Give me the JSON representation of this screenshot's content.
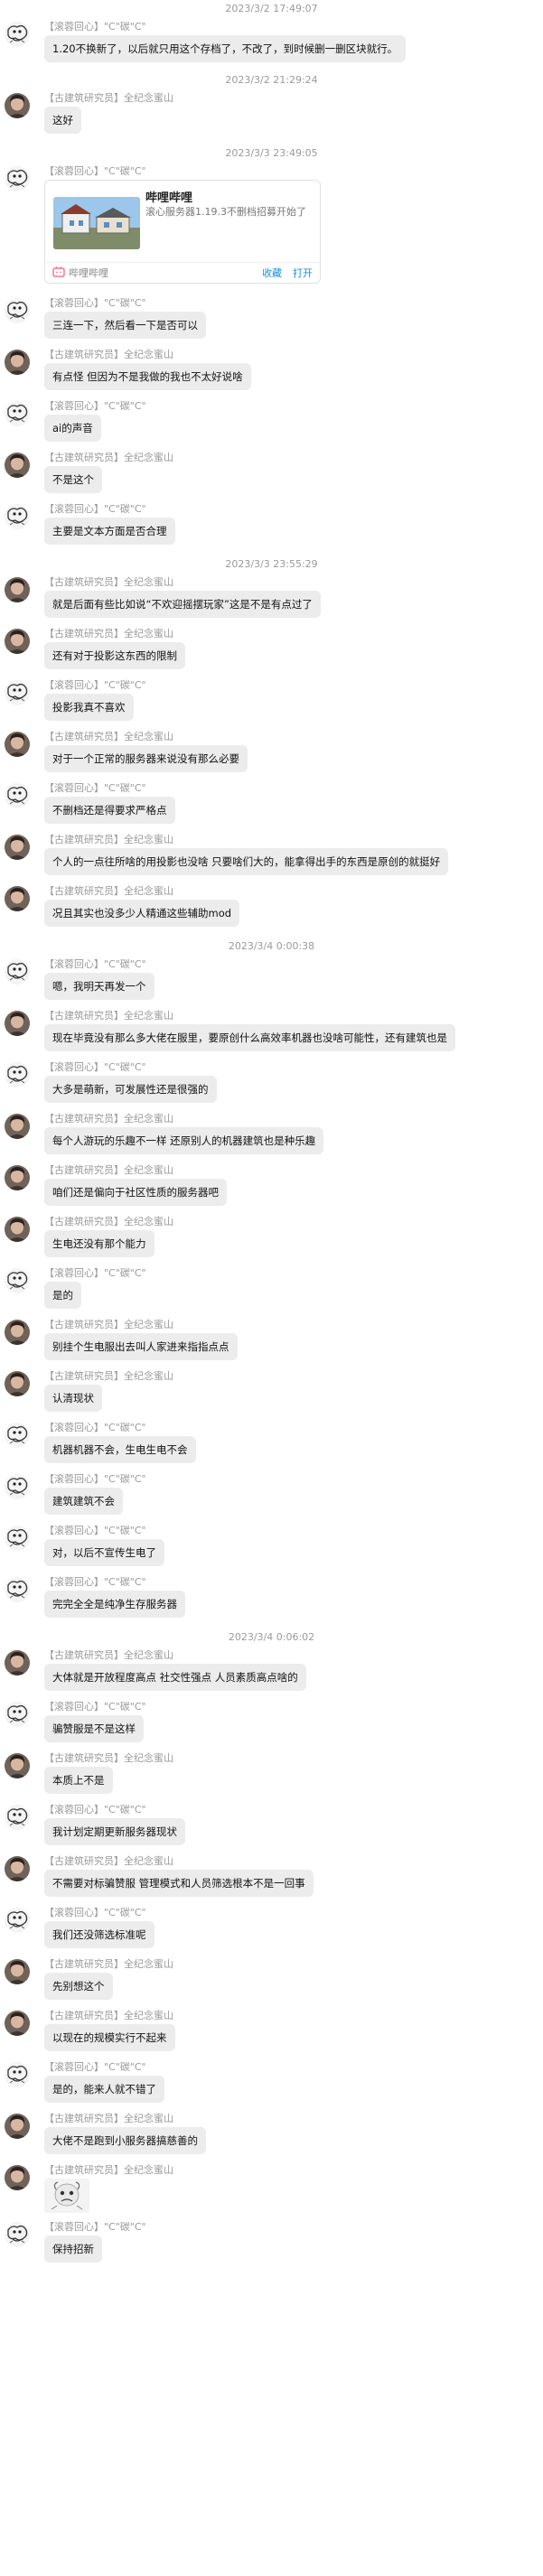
{
  "colors": {
    "bubble": "#ececec",
    "timestamp": "#9a9a9a",
    "link": "#1e8fd8",
    "bili_pink": "#fb7299"
  },
  "entries": [
    {
      "type": "ts",
      "text": "2023/3/2 17:49:07"
    },
    {
      "type": "msg",
      "who": "A",
      "name": "【滚蓉回心】\"C\"碳\"C\"",
      "text": "1.20不换新了，以后就只用这个存档了，不改了，到时候删一删区块就行。",
      "gap": 10
    },
    {
      "type": "ts",
      "text": "2023/3/2 21:29:24"
    },
    {
      "type": "msg",
      "who": "B",
      "name": "【古建筑研究员】全纪念蜜山",
      "text": "这好",
      "gap": 12
    },
    {
      "type": "ts",
      "text": "2023/3/3 23:49:05"
    },
    {
      "type": "card",
      "who": "A",
      "name": "【滚蓉回心】\"C\"碳\"C\"",
      "gap": 12,
      "card": {
        "title": "哔哩哔哩",
        "desc": "滚心服务器1.19.3不删档招募开始了",
        "source": "哔哩哔哩",
        "actions": [
          "收藏",
          "打开"
        ]
      }
    },
    {
      "type": "msg",
      "who": "A",
      "name": "【滚蓉回心】\"C\"碳\"C\"",
      "text": "三连一下，然后看一下是否可以",
      "gap": 8
    },
    {
      "type": "msg",
      "who": "B",
      "name": "【古建筑研究员】全纪念蜜山",
      "text": "有点怪 但因为不是我做的我也不太好说啥",
      "gap": 8
    },
    {
      "type": "msg",
      "who": "A",
      "name": "【滚蓉回心】\"C\"碳\"C\"",
      "text": "ai的声音",
      "gap": 8
    },
    {
      "type": "msg",
      "who": "B",
      "name": "【古建筑研究员】全纪念蜜山",
      "text": "不是这个",
      "gap": 8
    },
    {
      "type": "msg",
      "who": "A",
      "name": "【滚蓉回心】\"C\"碳\"C\"",
      "text": "主要是文本方面是否合理",
      "gap": 12
    },
    {
      "type": "ts",
      "text": "2023/3/3 23:55:29"
    },
    {
      "type": "msg",
      "who": "B",
      "name": "【古建筑研究员】全纪念蜜山",
      "text": "就是后面有些比如说“不欢迎摇摆玩家”这是不是有点过了",
      "gap": 8
    },
    {
      "type": "msg",
      "who": "B",
      "name": "【古建筑研究员】全纪念蜜山",
      "text": "还有对于投影这东西的限制",
      "gap": 8
    },
    {
      "type": "msg",
      "who": "A",
      "name": "【滚蓉回心】\"C\"碳\"C\"",
      "text": "投影我真不喜欢",
      "gap": 8
    },
    {
      "type": "msg",
      "who": "B",
      "name": "【古建筑研究员】全纪念蜜山",
      "text": "对于一个正常的服务器来说没有那么必要",
      "gap": 8
    },
    {
      "type": "msg",
      "who": "A",
      "name": "【滚蓉回心】\"C\"碳\"C\"",
      "text": "不删档还是得要求严格点",
      "gap": 8
    },
    {
      "type": "msg",
      "who": "B",
      "name": "【古建筑研究员】全纪念蜜山",
      "text": "个人的一点往所啥的用投影也没啥 只要啥们大的，能拿得出手的东西是原创的就挺好",
      "gap": 8
    },
    {
      "type": "msg",
      "who": "B",
      "name": "【古建筑研究员】全纪念蜜山",
      "text": "况且其实也没多少人精通这些辅助mod",
      "gap": 12
    },
    {
      "type": "ts",
      "text": "2023/3/4 0:00:38"
    },
    {
      "type": "msg",
      "who": "A",
      "name": "【滚蓉回心】\"C\"碳\"C\"",
      "text": "嗯，我明天再发一个",
      "gap": 8
    },
    {
      "type": "msg",
      "who": "B",
      "name": "【古建筑研究员】全纪念蜜山",
      "text": "现在毕竟没有那么多大佬在服里，要原创什么高效率机器也没啥可能性，还有建筑也是",
      "gap": 8
    },
    {
      "type": "msg",
      "who": "A",
      "name": "【滚蓉回心】\"C\"碳\"C\"",
      "text": "大多是萌新，可发展性还是很强的",
      "gap": 8
    },
    {
      "type": "msg",
      "who": "B",
      "name": "【古建筑研究员】全纪念蜜山",
      "text": "每个人游玩的乐趣不一样 还原别人的机器建筑也是种乐趣",
      "gap": 8
    },
    {
      "type": "msg",
      "who": "B",
      "name": "【古建筑研究员】全纪念蜜山",
      "text": "咱们还是偏向于社区性质的服务器吧",
      "gap": 8
    },
    {
      "type": "msg",
      "who": "B",
      "name": "【古建筑研究员】全纪念蜜山",
      "text": "生电还没有那个能力",
      "gap": 8
    },
    {
      "type": "msg",
      "who": "A",
      "name": "【滚蓉回心】\"C\"碳\"C\"",
      "text": "是的",
      "gap": 8
    },
    {
      "type": "msg",
      "who": "B",
      "name": "【古建筑研究员】全纪念蜜山",
      "text": "别挂个生电服出去叫人家进来指指点点",
      "gap": 8
    },
    {
      "type": "msg",
      "who": "B",
      "name": "【古建筑研究员】全纪念蜜山",
      "text": "认清现状",
      "gap": 8
    },
    {
      "type": "msg",
      "who": "A",
      "name": "【滚蓉回心】\"C\"碳\"C\"",
      "text": "机器机器不会，生电生电不会",
      "gap": 8
    },
    {
      "type": "msg",
      "who": "A",
      "name": "【滚蓉回心】\"C\"碳\"C\"",
      "text": "建筑建筑不会",
      "gap": 8
    },
    {
      "type": "msg",
      "who": "A",
      "name": "【滚蓉回心】\"C\"碳\"C\"",
      "text": "对，以后不宣传生电了",
      "gap": 8
    },
    {
      "type": "msg",
      "who": "A",
      "name": "【滚蓉回心】\"C\"碳\"C\"",
      "text": "完完全全是纯净生存服务器",
      "gap": 12
    },
    {
      "type": "ts",
      "text": "2023/3/4 0:06:02"
    },
    {
      "type": "msg",
      "who": "B",
      "name": "【古建筑研究员】全纪念蜜山",
      "text": "大体就是开放程度高点 社交性强点 人员素质高点啥的",
      "gap": 8
    },
    {
      "type": "msg",
      "who": "A",
      "name": "【滚蓉回心】\"C\"碳\"C\"",
      "text": "骗赞服是不是这样",
      "gap": 8
    },
    {
      "type": "msg",
      "who": "B",
      "name": "【古建筑研究员】全纪念蜜山",
      "text": "本质上不是",
      "gap": 8
    },
    {
      "type": "msg",
      "who": "A",
      "name": "【滚蓉回心】\"C\"碳\"C\"",
      "text": "我计划定期更新服务器现状",
      "gap": 8
    },
    {
      "type": "msg",
      "who": "B",
      "name": "【古建筑研究员】全纪念蜜山",
      "text": "不需要对标骗赞服 管理模式和人员筛选根本不是一回事",
      "gap": 8
    },
    {
      "type": "msg",
      "who": "A",
      "name": "【滚蓉回心】\"C\"碳\"C\"",
      "text": "我们还没筛选标准呢",
      "gap": 8
    },
    {
      "type": "msg",
      "who": "B",
      "name": "【古建筑研究员】全纪念蜜山",
      "text": "先别想这个",
      "gap": 8
    },
    {
      "type": "msg",
      "who": "B",
      "name": "【古建筑研究员】全纪念蜜山",
      "text": "以现在的规模实行不起来",
      "gap": 8
    },
    {
      "type": "msg",
      "who": "A",
      "name": "【滚蓉回心】\"C\"碳\"C\"",
      "text": "是的，能来人就不错了",
      "gap": 8
    },
    {
      "type": "msg",
      "who": "B",
      "name": "【古建筑研究员】全纪念蜜山",
      "text": "大佬不是跑到小服务器搞慈善的",
      "gap": 8
    },
    {
      "type": "sticker",
      "who": "B",
      "name": "【古建筑研究员】全纪念蜜山",
      "gap": 6
    },
    {
      "type": "msg",
      "who": "A",
      "name": "【滚蓉回心】\"C\"碳\"C\"",
      "text": "保持招新",
      "gap": 8
    }
  ]
}
